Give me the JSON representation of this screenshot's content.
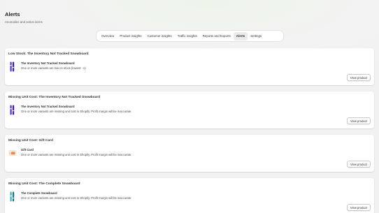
{
  "header": {
    "title": "Alerts",
    "subtitle": "Anomalies and action items"
  },
  "tabs": [
    {
      "label": "Overview",
      "active": false
    },
    {
      "label": "Product insights",
      "active": false
    },
    {
      "label": "Customer insights",
      "active": false
    },
    {
      "label": "Traffic insights",
      "active": false
    },
    {
      "label": "Reports and Exports",
      "active": false
    },
    {
      "label": "Alerts",
      "active": true
    },
    {
      "label": "Settings",
      "active": false
    }
  ],
  "alerts": [
    {
      "title": "Low Stock: The Inventory Not Tracked Snowboard",
      "product": "The Inventory Not Tracked Snowboard",
      "message": "One or more variants are low on stock (lowest: -1)",
      "thumbnail": "purple-snowboard-icon",
      "button": "View product"
    },
    {
      "title": "Missing Unit Cost: The Inventory Not Tracked Snowboard",
      "product": "The Inventory Not Tracked Snowboard",
      "message": "One or more variants are missing unit cost in Shopify. Profit margin will be inaccurate.",
      "thumbnail": "purple-snowboard-icon",
      "button": "View product"
    },
    {
      "title": "Missing Unit Cost: Gift Card",
      "product": "Gift Card",
      "message": "One or more variants are missing unit cost in Shopify. Profit margin will be inaccurate.",
      "thumbnail": "gift-card-icon",
      "button": "View product"
    },
    {
      "title": "Missing Unit Cost: The Complete Snowboard",
      "product": "The Complete Snowboard",
      "message": "One or more variants are missing unit cost in Shopify. Profit margin will be inaccurate.",
      "thumbnail": "teal-snowboard-icon",
      "button": "View product"
    }
  ],
  "colors": {
    "background": "#f1f1f1",
    "card": "#ffffff",
    "active_tab": "#ebebeb",
    "snowboard_purple": "#5b2bd6",
    "snowboard_teal": "#2fb7b0",
    "gift_card": "#e58a4e"
  }
}
